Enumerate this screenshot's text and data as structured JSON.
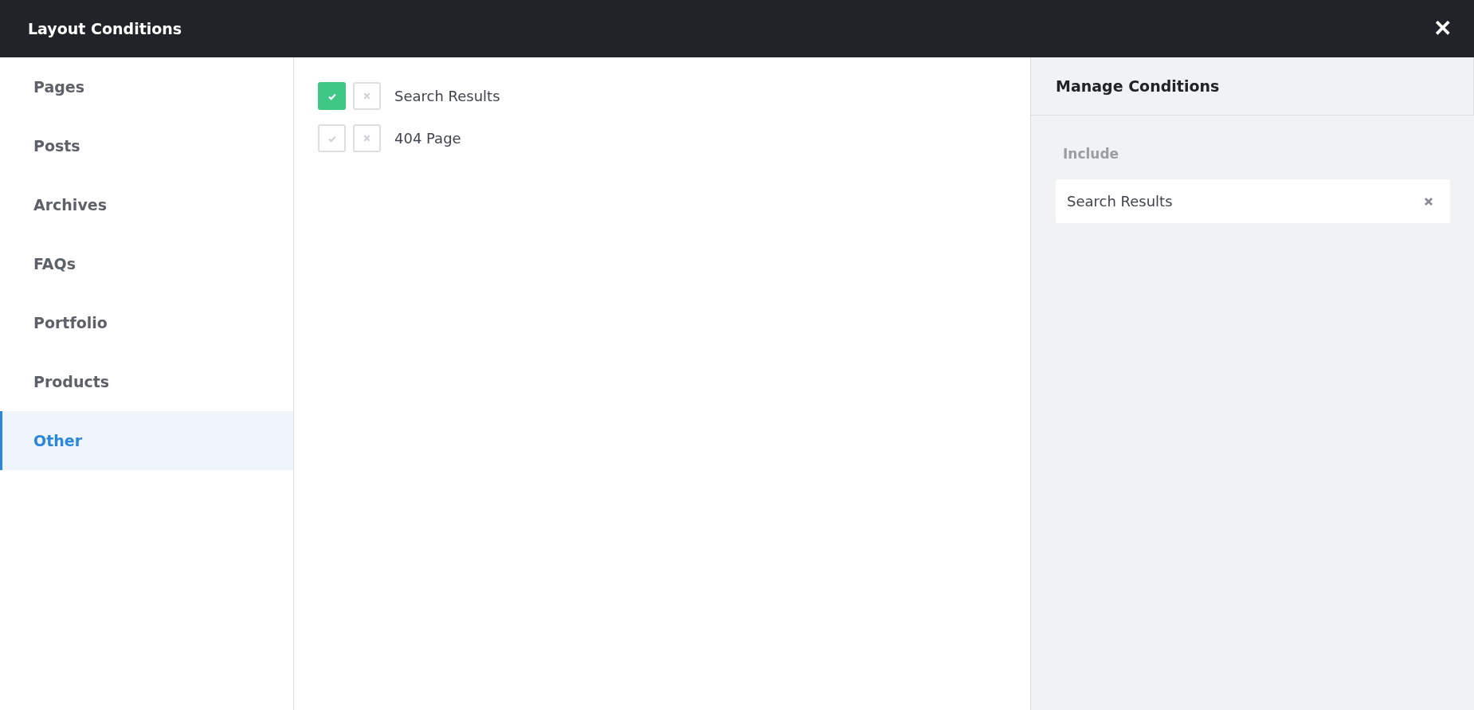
{
  "window": {
    "title": "Layout Conditions",
    "close": "✕"
  },
  "sidebar": {
    "items": [
      {
        "label": "Pages",
        "selected": false
      },
      {
        "label": "Posts",
        "selected": false
      },
      {
        "label": "Archives",
        "selected": false
      },
      {
        "label": "FAQs",
        "selected": false
      },
      {
        "label": "Portfolio",
        "selected": false
      },
      {
        "label": "Products",
        "selected": false
      },
      {
        "label": "Other",
        "selected": true
      }
    ]
  },
  "conditions": [
    {
      "label": "Search Results",
      "included": true,
      "excluded": false
    },
    {
      "label": "404 Page",
      "included": false,
      "excluded": false
    }
  ],
  "manage": {
    "title": "Manage Conditions",
    "sections": [
      {
        "label": "Include",
        "items": [
          {
            "label": "Search Results"
          }
        ]
      }
    ]
  }
}
